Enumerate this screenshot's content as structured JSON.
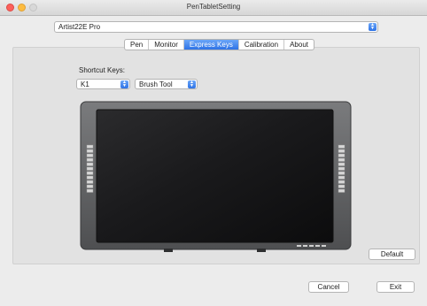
{
  "window": {
    "title": "PenTabletSetting"
  },
  "device": {
    "selected": "Artist22E Pro"
  },
  "tabs": [
    {
      "label": "Pen",
      "active": false
    },
    {
      "label": "Monitor",
      "active": false
    },
    {
      "label": "Express Keys",
      "active": true
    },
    {
      "label": "Calibration",
      "active": false
    },
    {
      "label": "About",
      "active": false
    }
  ],
  "express_keys": {
    "shortcut_label": "Shortcut Keys:",
    "key_selected": "K1",
    "function_selected": "Brush Tool"
  },
  "buttons": {
    "default": "Default",
    "cancel": "Cancel",
    "exit": "Exit"
  },
  "colors": {
    "accent": "#2e73e6",
    "close": "#fc605b",
    "minimize": "#fdbc40",
    "bezel": "#5f6062",
    "screen": "#1c1c1e"
  }
}
